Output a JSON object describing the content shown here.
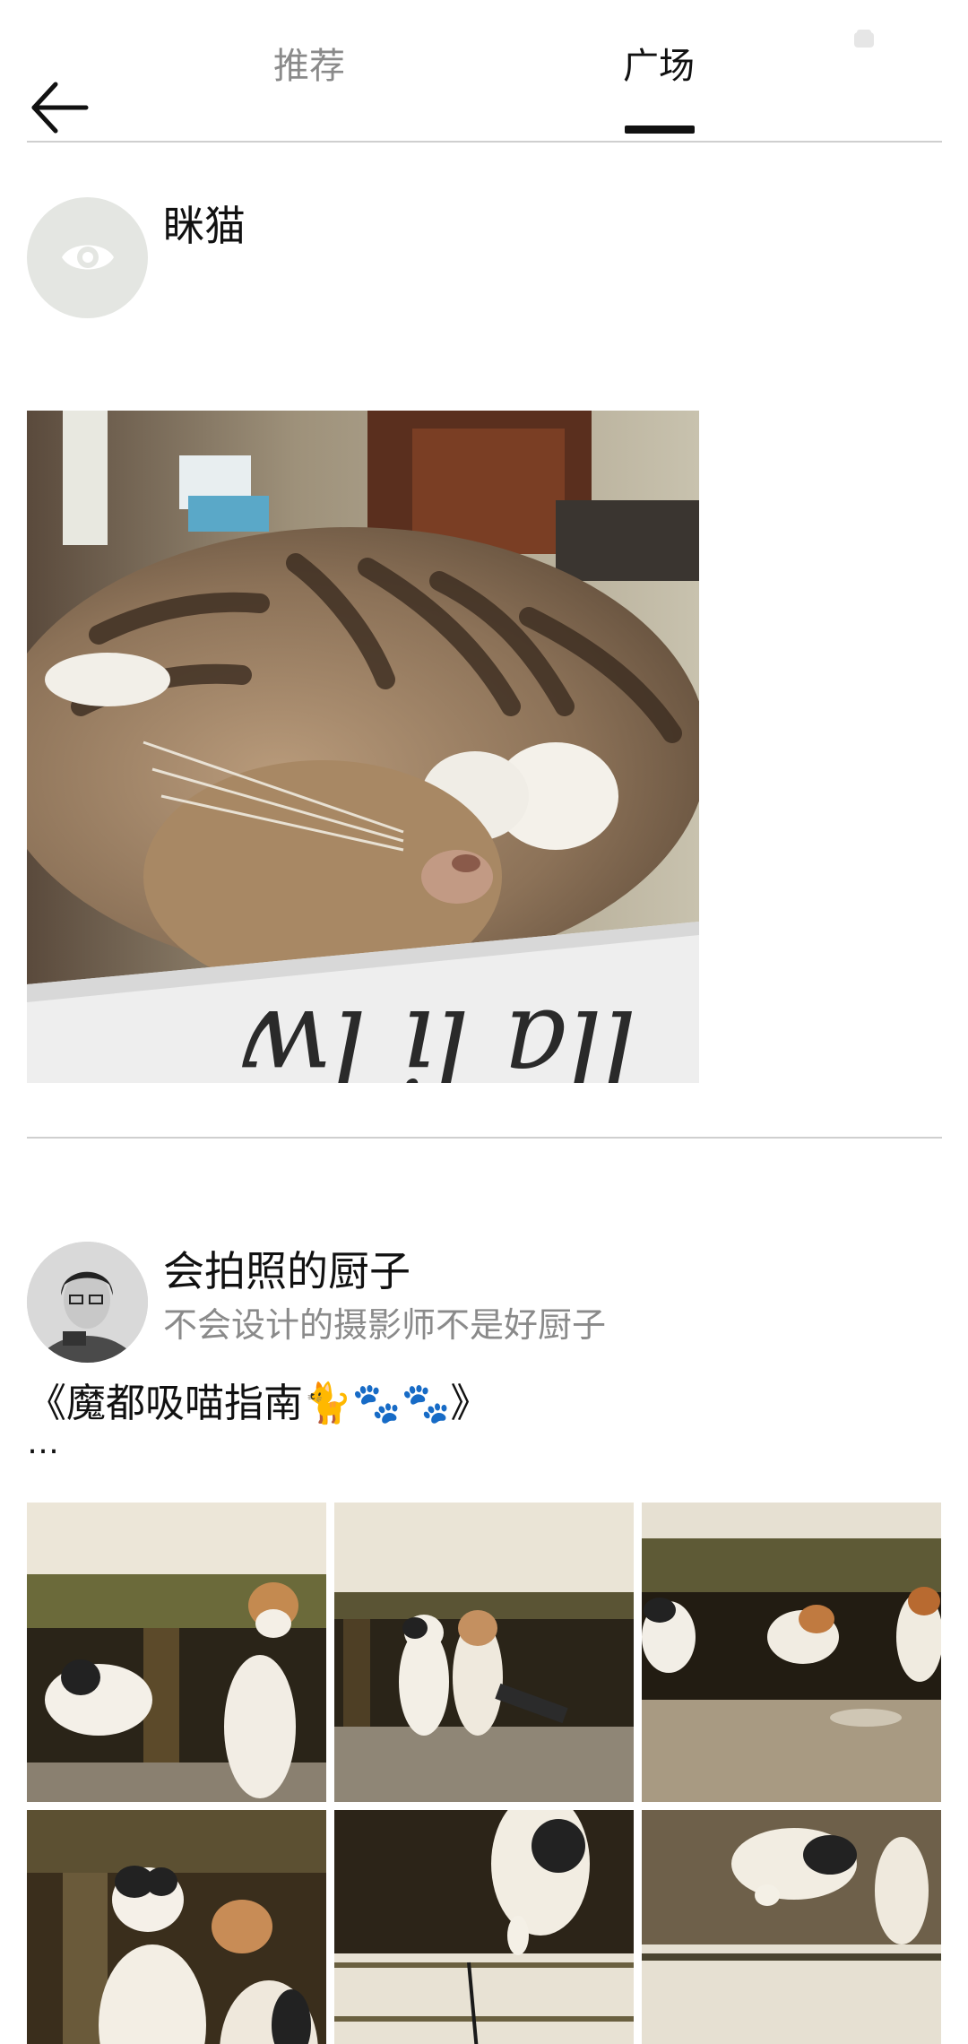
{
  "header": {
    "tabs": [
      {
        "label": "推荐",
        "active": false
      },
      {
        "label": "广场",
        "active": true
      }
    ]
  },
  "posts": [
    {
      "author": "眯猫",
      "avatar_icon": "eye-icon",
      "photo": "sleeping-tabby-cat-photo"
    },
    {
      "author": "会拍照的厨子",
      "bio": "不会设计的摄影师不是好厨子",
      "title": "《魔都吸喵指南🐈🐾🐾》",
      "more": "…",
      "photos": [
        "cats-under-bench-1",
        "cats-under-bench-2",
        "cats-under-bench-3",
        "cats-closeup-4",
        "cat-walking-5",
        "cat-paws-6"
      ]
    }
  ],
  "colors": {
    "active_tab": "#111111",
    "inactive_tab": "#8a8a8a",
    "divider": "#cfcfcf",
    "avatar_placeholder": "#e4e6e2"
  }
}
